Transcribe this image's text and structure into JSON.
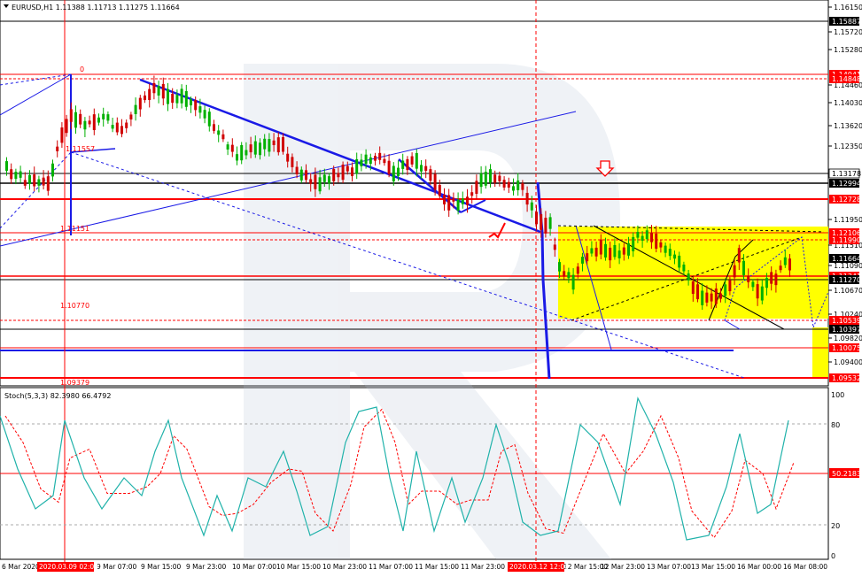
{
  "header": {
    "symbol_line": "EURUSD,H1  1.11388 1.11713 1.11275 1.11664"
  },
  "indicator": {
    "label": "Stoch(5,3,3) 82.3980 66.4792",
    "scale": [
      "100",
      "80",
      "20",
      "0"
    ],
    "marker": "50.2183"
  },
  "price_axis": {
    "ticks": [
      "1.16150",
      "1.15720",
      "1.15280",
      "1.14460",
      "1.14030",
      "1.13620",
      "1.12350",
      "1.11950",
      "1.11510",
      "1.11090",
      "1.10670",
      "1.10240",
      "1.09820",
      "1.09400"
    ],
    "labels": [
      {
        "text": "1.15887",
        "kind": "black"
      },
      {
        "text": "1.14941",
        "kind": "red"
      },
      {
        "text": "1.14848",
        "kind": "red"
      },
      {
        "text": "1.13178",
        "kind": "white"
      },
      {
        "text": "1.12994",
        "kind": "black"
      },
      {
        "text": "1.12728",
        "kind": "red"
      },
      {
        "text": "1.12106",
        "kind": "red"
      },
      {
        "text": "1.11990",
        "kind": "red"
      },
      {
        "text": "1.11664",
        "kind": "black"
      },
      {
        "text": "1.11341",
        "kind": "red"
      },
      {
        "text": "1.11270",
        "kind": "black"
      },
      {
        "text": "1.10539",
        "kind": "red"
      },
      {
        "text": "1.10397",
        "kind": "black"
      },
      {
        "text": "1.10075",
        "kind": "red"
      },
      {
        "text": "1.09532",
        "kind": "red"
      }
    ]
  },
  "chart_labels": {
    "fib_zero": "0",
    "fib_1": "1.11557",
    "fib_2": "1.11151",
    "fib_3": "1.10770",
    "fib_4": "1.09379"
  },
  "time_axis": {
    "ticks": [
      "6 Mar 2020",
      "9 Mar 07:00",
      "9 Mar 15:00",
      "9 Mar 23:00",
      "10 Mar 07:00",
      "10 Mar 15:00",
      "10 Mar 23:00",
      "11 Mar 07:00",
      "11 Mar 15:00",
      "11 Mar 23:00",
      "12 Mar 15:00",
      "12 Mar 23:00",
      "13 Mar 07:00",
      "13 Mar 15:00",
      "16 Mar 00:00",
      "16 Mar 08:00"
    ],
    "highlight_1": "2020.03.09 02:00",
    "highlight_2": "2020.03.12 12:00"
  },
  "colors": {
    "up": "#00b000",
    "down": "#d00000",
    "level_red": "#ff0000",
    "trend_blue": "#1a1ae6",
    "zone_yellow": "#ffff00",
    "stoch_main": "#20b2aa",
    "stoch_signal": "#ff0000"
  }
}
